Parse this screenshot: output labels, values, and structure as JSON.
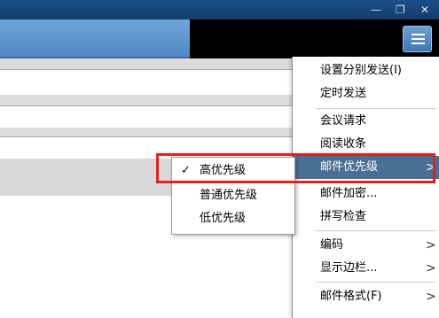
{
  "colors": {
    "titlebar": "#1c4f87",
    "menu_highlight": "#4a6f94",
    "annotation_red": "#e2201c"
  },
  "titlebar": {
    "minimize_glyph": "—",
    "restore_glyph": "❐",
    "close_glyph": "✕"
  },
  "toolbar": {
    "options_icon": "list-icon"
  },
  "menu": {
    "items": [
      {
        "label": "设置分别发送(I)"
      },
      {
        "label": "定时发送"
      },
      {
        "label": "会议请求"
      },
      {
        "label": "阅读收条"
      },
      {
        "label": "邮件优先级",
        "arrow": ">",
        "highlighted": true
      },
      {
        "label": "邮件加密..."
      },
      {
        "label": "拼写检查"
      },
      {
        "label": "编码",
        "arrow": ">"
      },
      {
        "label": "显示边栏...",
        "arrow": ">"
      },
      {
        "label": "邮件格式(F)",
        "arrow": ">"
      }
    ]
  },
  "submenu": {
    "items": [
      {
        "label": "高优先级",
        "check": "✓",
        "checked": true
      },
      {
        "label": "普通优先级"
      },
      {
        "label": "低优先级"
      }
    ]
  }
}
